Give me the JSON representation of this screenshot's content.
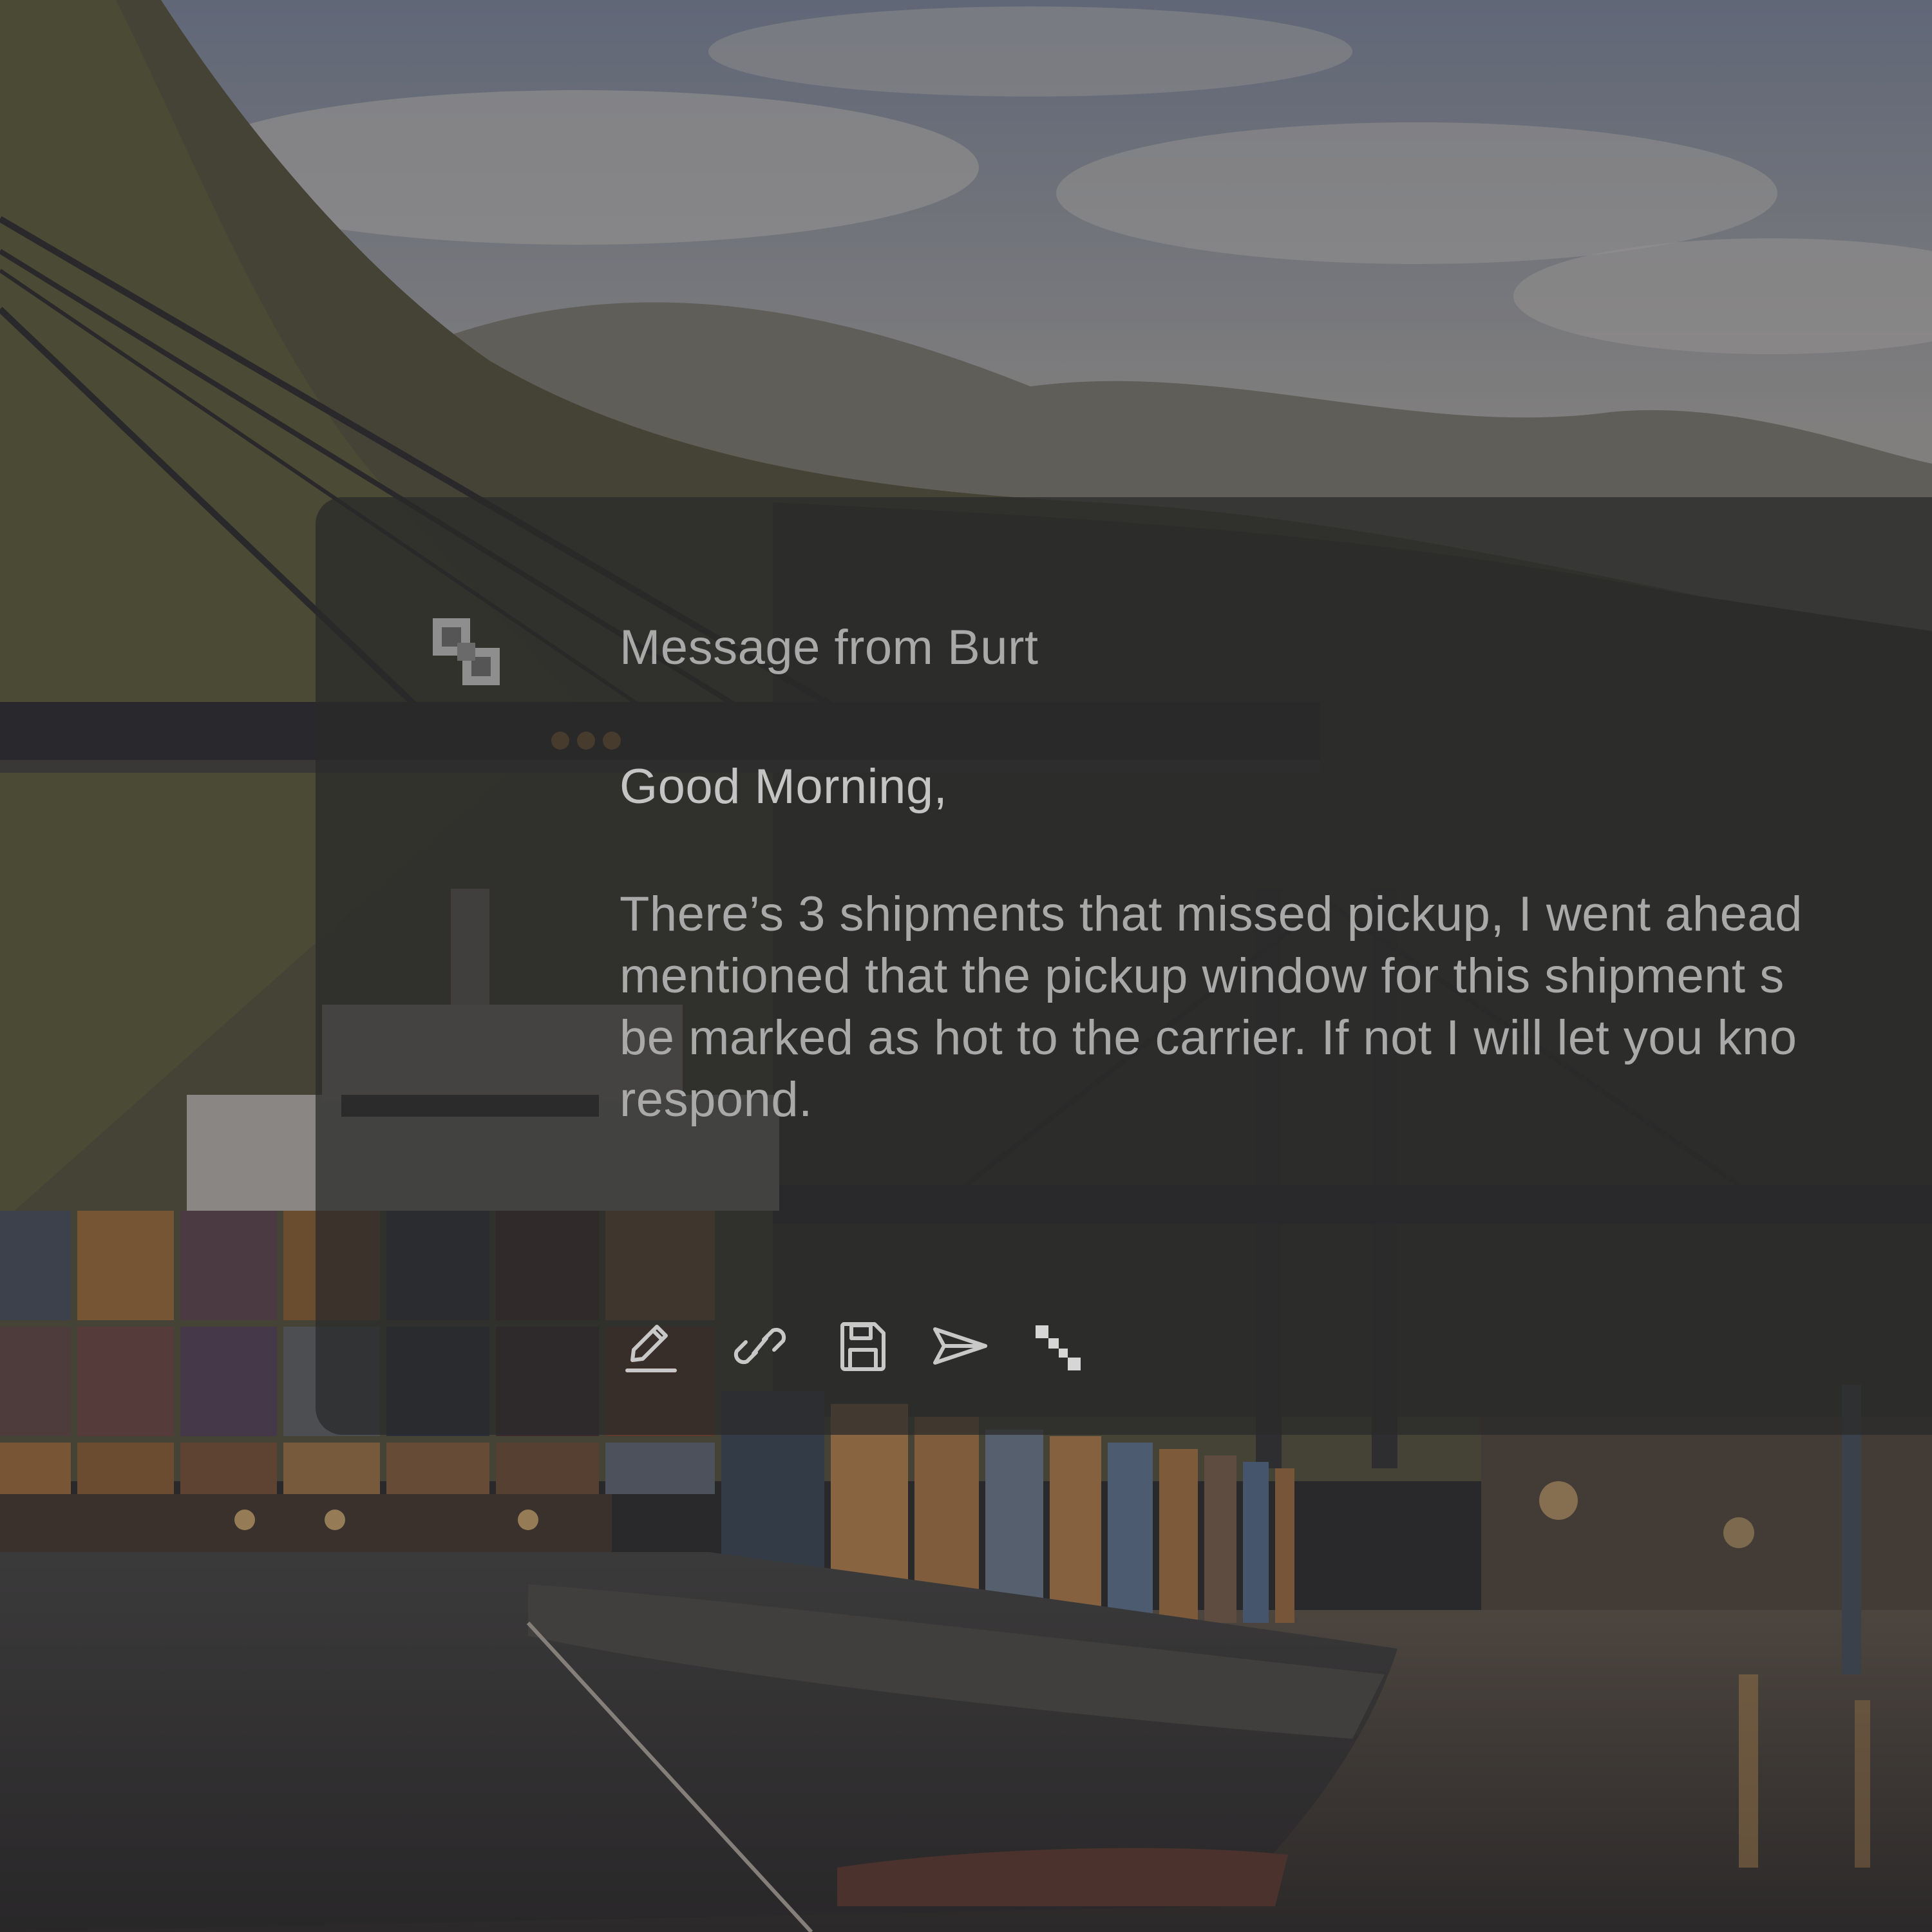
{
  "message": {
    "title": "Message from Burt",
    "greeting": "Good Morning,",
    "body_lines": [
      "There’s 3 shipments that missed pickup, I went ahead",
      "mentioned that the pickup window for this shipment s",
      "be marked as hot to the carrier. If not I will let you kno",
      "respond."
    ]
  },
  "toolbar": {
    "icons": [
      "pencil-icon",
      "link-icon",
      "save-icon",
      "send-icon",
      "expand-icon"
    ]
  },
  "colors": {
    "card_background": "#2a2a2a",
    "title_text": "#a9a9a9",
    "greeting_text": "#c4c4c4",
    "icon_stroke": "#c8c8c8"
  }
}
